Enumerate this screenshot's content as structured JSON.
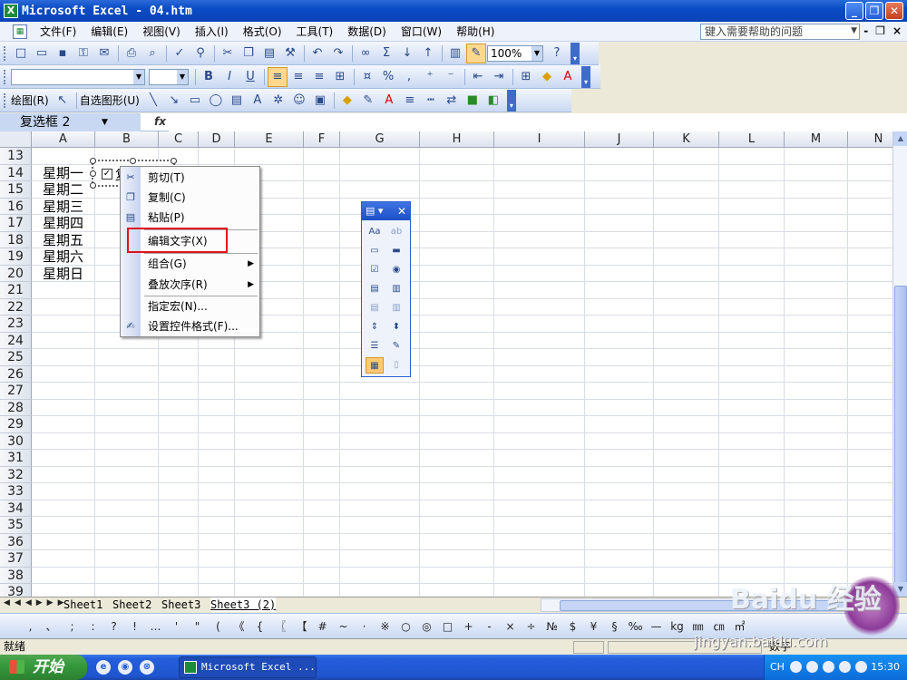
{
  "window": {
    "title": "Microsoft Excel - 04.htm",
    "buttons": [
      "_",
      "❐",
      "✕"
    ]
  },
  "menu": {
    "items": [
      "文件(F)",
      "编辑(E)",
      "视图(V)",
      "插入(I)",
      "格式(O)",
      "工具(T)",
      "数据(D)",
      "窗口(W)",
      "帮助(H)"
    ],
    "help_placeholder": "键入需要帮助的问题",
    "mdi_buttons": [
      "-",
      "❐",
      "×"
    ]
  },
  "standard_toolbar": {
    "zoom": "100%"
  },
  "drawing_toolbar": {
    "draw_label": "绘图(R)",
    "autoshapes_label": "自选图形(U)"
  },
  "formula_bar": {
    "name_box": "复选框 2",
    "fx": "fx"
  },
  "sheet": {
    "columns": [
      "A",
      "B",
      "C",
      "D",
      "E",
      "F",
      "G",
      "H",
      "I",
      "J",
      "K",
      "L",
      "M",
      "N"
    ],
    "rows": [
      "13",
      "14",
      "15",
      "16",
      "17",
      "18",
      "19",
      "20",
      "21",
      "22",
      "23",
      "24",
      "25",
      "26",
      "27",
      "28",
      "29",
      "30",
      "31",
      "32",
      "33",
      "34",
      "35",
      "36",
      "37",
      "38",
      "39"
    ],
    "col_a_values": [
      "星期一",
      "星期二",
      "星期三",
      "星期四",
      "星期五",
      "星期六",
      "星期日"
    ],
    "checkbox_label": "复"
  },
  "context_menu": {
    "items": [
      {
        "label": "剪切(T)",
        "icon": "scissors-icon"
      },
      {
        "label": "复制(C)",
        "icon": "copy-icon"
      },
      {
        "label": "粘贴(P)",
        "icon": "paste-icon"
      },
      {
        "label": "编辑文字(X)",
        "icon": ""
      },
      {
        "label": "组合(G)",
        "icon": ""
      },
      {
        "label": "叠放次序(R)",
        "icon": ""
      },
      {
        "label": "指定宏(N)...",
        "icon": ""
      },
      {
        "label": "设置控件格式(F)...",
        "icon": "format-control-icon"
      }
    ]
  },
  "tabs": [
    "Sheet1",
    "Sheet2",
    "Sheet3",
    "Sheet3 (2)"
  ],
  "symbol_bar": {
    "symbols": [
      ",",
      "、",
      ";",
      ":",
      "?",
      "!",
      "…",
      "'",
      "\"",
      "(",
      "《",
      "{",
      "〖",
      "【",
      "#",
      "~",
      "·",
      "※",
      "○",
      "◎",
      "□",
      "+",
      "-",
      "×",
      "÷",
      "№",
      "$",
      "¥",
      "§",
      "‰",
      "—",
      "kg",
      "㎜",
      "㎝",
      "㎡"
    ]
  },
  "status": {
    "left": "就绪",
    "right": "数字"
  },
  "taskbar": {
    "start": "开始",
    "task": "Microsoft Excel ...",
    "lang": "CH",
    "time": "15:30"
  },
  "watermark": {
    "brand": "Baidu 经验",
    "url": "jingyan.baidu.com"
  },
  "colors": {
    "title_blue": "#0b4bc4",
    "highlight_red": "#e0121a",
    "taskbar_blue": "#245edb"
  }
}
